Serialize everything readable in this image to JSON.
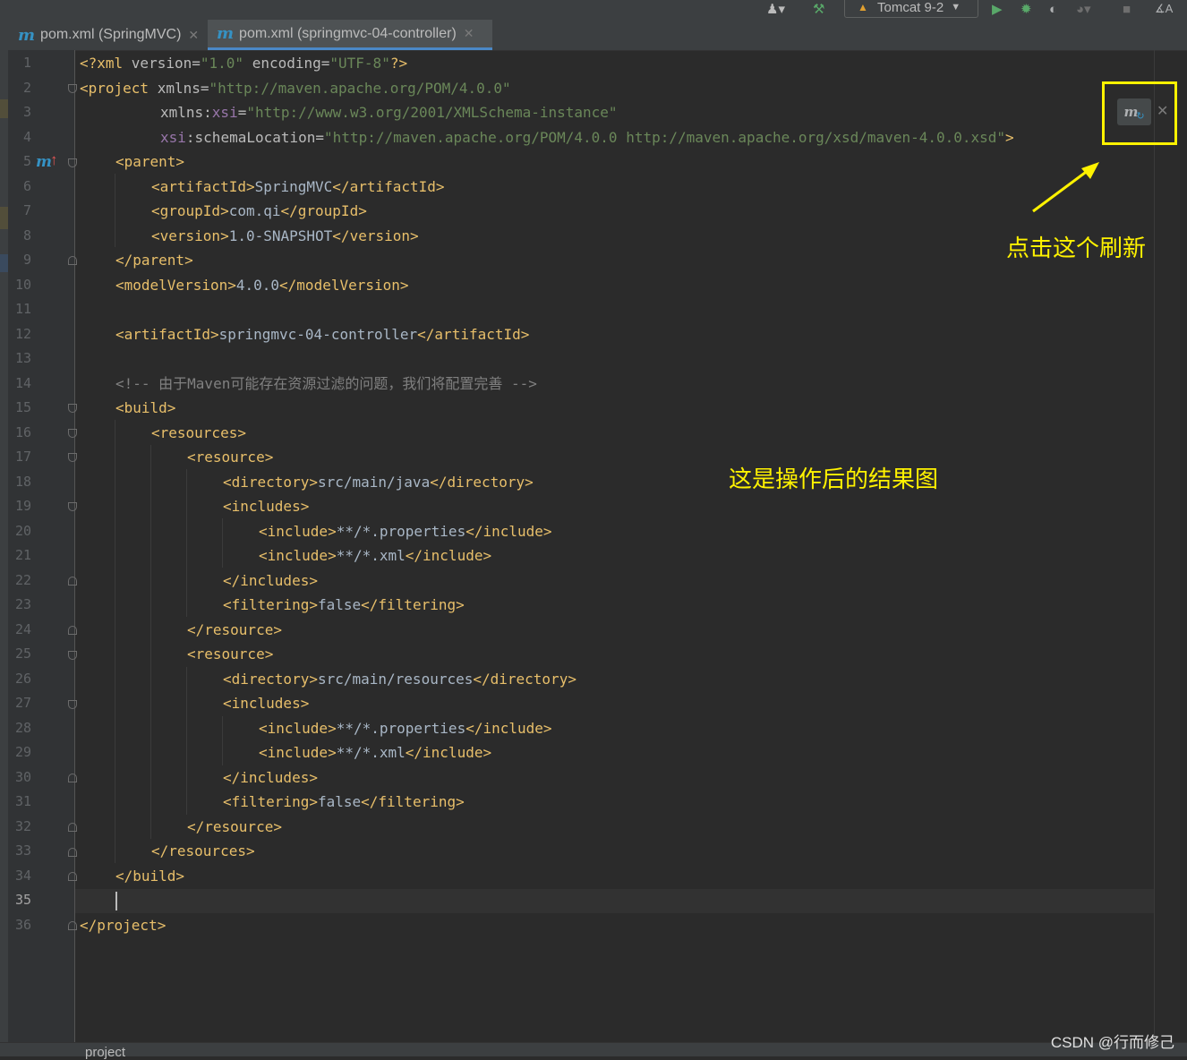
{
  "run_config": {
    "label": "Tomcat 9-2"
  },
  "tabs": [
    {
      "icon": "m",
      "label": "pom.xml (SpringMVC)"
    },
    {
      "icon": "m",
      "label": "pom.xml (springmvc-04-controller)"
    }
  ],
  "line_numbers": [
    "1",
    "2",
    "3",
    "4",
    "5",
    "6",
    "7",
    "8",
    "9",
    "10",
    "11",
    "12",
    "13",
    "14",
    "15",
    "16",
    "17",
    "18",
    "19",
    "20",
    "21",
    "22",
    "23",
    "24",
    "25",
    "26",
    "27",
    "28",
    "29",
    "30",
    "31",
    "32",
    "33",
    "34",
    "35",
    "36"
  ],
  "current_line": "35",
  "code": {
    "xml_decl": {
      "open": "<?xml ",
      "version_attr": "version",
      "eq1": "=",
      "version_val": "\"1.0\"",
      "sp": " ",
      "enc_attr": "encoding",
      "eq2": "=",
      "enc_val": "\"UTF-8\"",
      "close": "?>"
    },
    "project_open": {
      "tag": "<project ",
      "attr": "xmlns",
      "eq": "=",
      "val": "\"http://maven.apache.org/POM/4.0.0\""
    },
    "line3": {
      "attr": "xmlns:",
      "ns": "xsi",
      "eq": "=",
      "val": "\"http://www.w3.org/2001/XMLSchema-instance\""
    },
    "line4": {
      "ns": "xsi",
      "attr": ":schemaLocation",
      "eq": "=",
      "val": "\"http://maven.apache.org/POM/4.0.0 http://maven.apache.org/xsd/maven-4.0.0.xsd\"",
      "close": ">"
    },
    "parent_open": "<parent>",
    "artifactId_open": "<artifactId>",
    "artifactId_parent": "SpringMVC",
    "artifactId_close": "</artifactId>",
    "groupId_open": "<groupId>",
    "groupId": "com.qi",
    "groupId_close": "</groupId>",
    "version_open": "<version>",
    "version": "1.0-SNAPSHOT",
    "version_close": "</version>",
    "parent_close": "</parent>",
    "modelVersion_open": "<modelVersion>",
    "modelVersion": "4.0.0",
    "modelVersion_close": "</modelVersion>",
    "artifactId_module": "springmvc-04-controller",
    "comment": "<!-- 由于Maven可能存在资源过滤的问题，我们将配置完善 -->",
    "build_open": "<build>",
    "resources_open": "<resources>",
    "resource_open": "<resource>",
    "directory_open": "<directory>",
    "directory_java": "src/main/java",
    "directory_close": "</directory>",
    "includes_open": "<includes>",
    "include_open": "<include>",
    "include_props": "**/*.properties",
    "include_xml": "**/*.xml",
    "include_close": "</include>",
    "includes_close": "</includes>",
    "filtering_open": "<filtering>",
    "filtering_val": "false",
    "filtering_close": "</filtering>",
    "resource_close": "</resource>",
    "directory_resources": "src/main/resources",
    "resources_close": "</resources>",
    "build_close": "</build>",
    "project_close": "</project>"
  },
  "maven_reload": {
    "icon": "maven-reload-icon"
  },
  "annotations": {
    "click_refresh": "点击这个刷新",
    "result": "这是操作后的结果图"
  },
  "breadcrumb": "project",
  "watermark": "CSDN @行而修己",
  "colors": {
    "tag": "#e8bf6a",
    "value": "#6a8759",
    "namespace": "#9876aa",
    "comment": "#808080",
    "highlight": "#fff200",
    "background": "#2b2b2b"
  }
}
